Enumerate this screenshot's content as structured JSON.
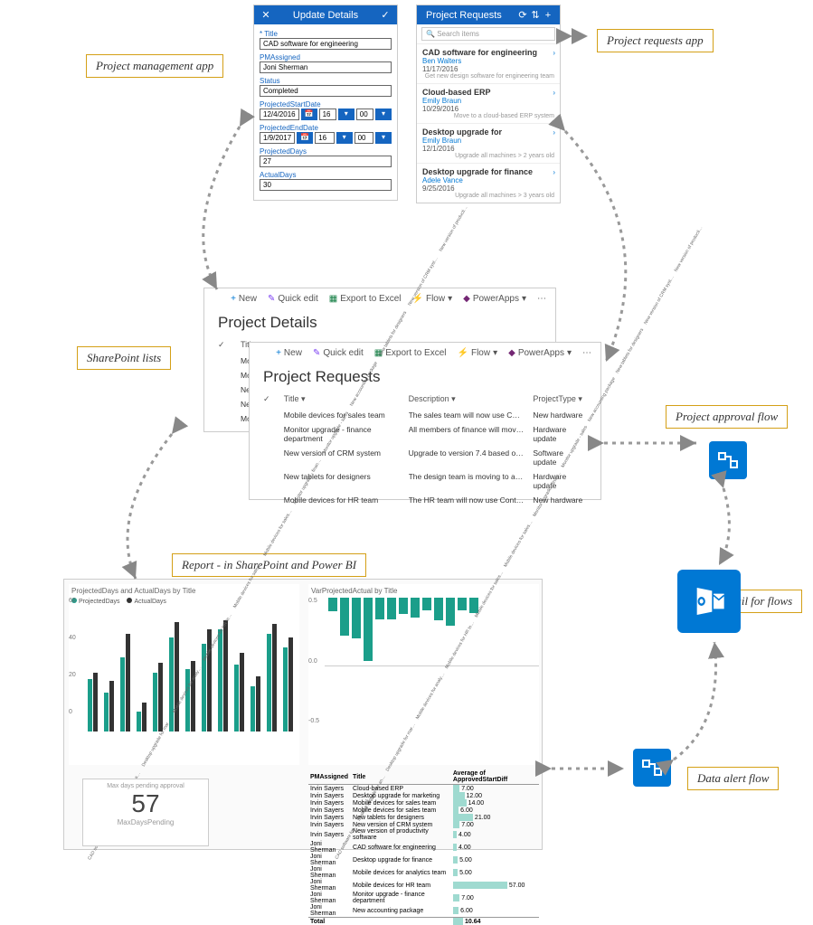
{
  "labels": {
    "pm_app": "Project management app",
    "pr_app": "Project requests app",
    "sp_lists": "SharePoint lists",
    "approval": "Project approval flow",
    "report": "Report - in SharePoint and Power BI",
    "email": "Email for flows",
    "alert": "Data alert flow"
  },
  "update_details": {
    "title_bar": "Update Details",
    "fields": {
      "title_lbl": "* Title",
      "title_val": "CAD software for engineering",
      "pm_lbl": "PMAssigned",
      "pm_val": "Joni Sherman",
      "status_lbl": "Status",
      "status_val": "Completed",
      "psd_lbl": "ProjectedStartDate",
      "psd_val": "12/4/2016",
      "psd_h": "16",
      "psd_m": "00",
      "ped_lbl": "ProjectedEndDate",
      "ped_val": "1/9/2017",
      "ped_h": "16",
      "ped_m": "00",
      "pdays_lbl": "ProjectedDays",
      "pdays_val": "27",
      "adays_lbl": "ActualDays",
      "adays_val": "30"
    }
  },
  "project_requests": {
    "title_bar": "Project Requests",
    "search_ph": "Search items",
    "items": [
      {
        "t": "CAD software for engineering",
        "p": "Ben Walters",
        "d": "11/17/2016",
        "desc": "Get new design software for engineering team"
      },
      {
        "t": "Cloud-based ERP",
        "p": "Emily Braun",
        "d": "10/29/2016",
        "desc": "Move to a cloud-based ERP system"
      },
      {
        "t": "Desktop upgrade for",
        "p": "Emily Braun",
        "d": "12/1/2016",
        "desc": "Upgrade all machines > 2 years old"
      },
      {
        "t": "Desktop upgrade for finance",
        "p": "Adele Vance",
        "d": "9/25/2016",
        "desc": "Upgrade all machines > 3 years old"
      }
    ]
  },
  "sp_toolbar": {
    "new": "New",
    "quick": "Quick edit",
    "export": "Export to Excel",
    "flow": "Flow",
    "pa": "PowerApps"
  },
  "sp1": {
    "heading": "Project Details",
    "col_title": "Title",
    "rows": [
      "Mobile",
      "Monit",
      "New ve",
      "New ta",
      "Mobile"
    ]
  },
  "sp2": {
    "heading": "Project Requests",
    "cols": {
      "title": "Title",
      "desc": "Description",
      "type": "ProjectType"
    },
    "rows": [
      {
        "t": "Mobile devices for sales team",
        "d": "The sales team will now use Contoso-supplied …",
        "ty": "New hardware"
      },
      {
        "t": "Monitor upgrade - finance department",
        "d": "All members of finance will move from 19-inch",
        "ty": "Hardware update"
      },
      {
        "t": "New version of CRM system",
        "d": "Upgrade to version 7.4 based on new features",
        "ty": "Software update"
      },
      {
        "t": "New tablets for designers",
        "d": "The design team is moving to a new brand of t…",
        "ty": "Hardware update"
      },
      {
        "t": "Mobile devices for HR team",
        "d": "The HR team will now use Contoso-supplied de…",
        "ty": "New hardware"
      }
    ]
  },
  "report": {
    "chartA_title": "ProjectedDays and ActualDays by Title",
    "legendA": {
      "s1": "ProjectedDays",
      "s2": "ActualDays"
    },
    "chartB_title": "VarProjectedActual by Title",
    "card": {
      "lbl": "Max days pending approval",
      "val": "57",
      "sub": "MaxDaysPending"
    }
  },
  "chart_data": [
    {
      "type": "bar",
      "title": "ProjectedDays and ActualDays by Title",
      "ylim": [
        0,
        60
      ],
      "categories": [
        "CAD software for…",
        "Desktop upgrade for ana…",
        "Desktop upgrade for mar…",
        "Mobile devices for analy…",
        "Mobile devices for HR te…",
        "Mobile devices for sales…",
        "Mobile devices for sales…",
        "Monitor upgrade - finan…",
        "Monitor upgrade - sales",
        "New accounting package",
        "New tablets for designers",
        "New version of CRM syst…",
        "New version of producti…"
      ],
      "series": [
        {
          "name": "ProjectedDays",
          "values": [
            27,
            20,
            38,
            10,
            30,
            48,
            32,
            45,
            52,
            34,
            23,
            50,
            43
          ]
        },
        {
          "name": "ActualDays",
          "values": [
            30,
            26,
            50,
            15,
            35,
            56,
            36,
            52,
            57,
            40,
            28,
            55,
            48
          ]
        }
      ]
    },
    {
      "type": "bar",
      "title": "VarProjectedActual by Title",
      "ylim": [
        -0.5,
        0.5
      ],
      "categories": [
        "CAD software for…",
        "Desktop upgrade for an…",
        "Desktop upgrade for mar…",
        "Mobile devices for analy…",
        "Mobile devices for HR te…",
        "Mobile devices for sales…",
        "Mobile devices for sales…",
        "Monitor upgrade - finan…",
        "Monitor upgrade - sales",
        "New accounting package",
        "New tablets for designers",
        "New version of CRM syst…",
        "New version of producti…"
      ],
      "values": [
        0.11,
        0.3,
        0.32,
        0.5,
        0.17,
        0.17,
        0.13,
        0.16,
        0.1,
        0.18,
        0.22,
        0.1,
        0.12
      ]
    },
    {
      "type": "card",
      "title": "Max days pending approval",
      "value": 57,
      "label": "MaxDaysPending"
    },
    {
      "type": "table",
      "columns": [
        "PMAssigned",
        "Title",
        "Average of ApprovedStartDiff"
      ],
      "rows": [
        [
          "Irvin Sayers",
          "Cloud-based ERP",
          7.0
        ],
        [
          "Irvin Sayers",
          "Desktop upgrade for marketing",
          12.0
        ],
        [
          "Irvin Sayers",
          "Mobile devices for sales team",
          14.0
        ],
        [
          "Irvin Sayers",
          "Mobile devices for sales team",
          6.0
        ],
        [
          "Irvin Sayers",
          "New tablets for designers",
          21.0
        ],
        [
          "Irvin Sayers",
          "New version of CRM system",
          7.0
        ],
        [
          "Irvin Sayers",
          "New version of productivity software",
          4.0
        ],
        [
          "Joni Sherman",
          "CAD software for engineering",
          4.0
        ],
        [
          "Joni Sherman",
          "Desktop upgrade for finance",
          5.0
        ],
        [
          "Joni Sherman",
          "Mobile devices for analytics team",
          5.0
        ],
        [
          "Joni Sherman",
          "Mobile devices for HR team",
          57.0
        ],
        [
          "Joni Sherman",
          "Monitor upgrade - finance department",
          7.0
        ],
        [
          "Joni Sherman",
          "New accounting package",
          6.0
        ],
        [
          "Total",
          "",
          10.64
        ]
      ]
    }
  ]
}
